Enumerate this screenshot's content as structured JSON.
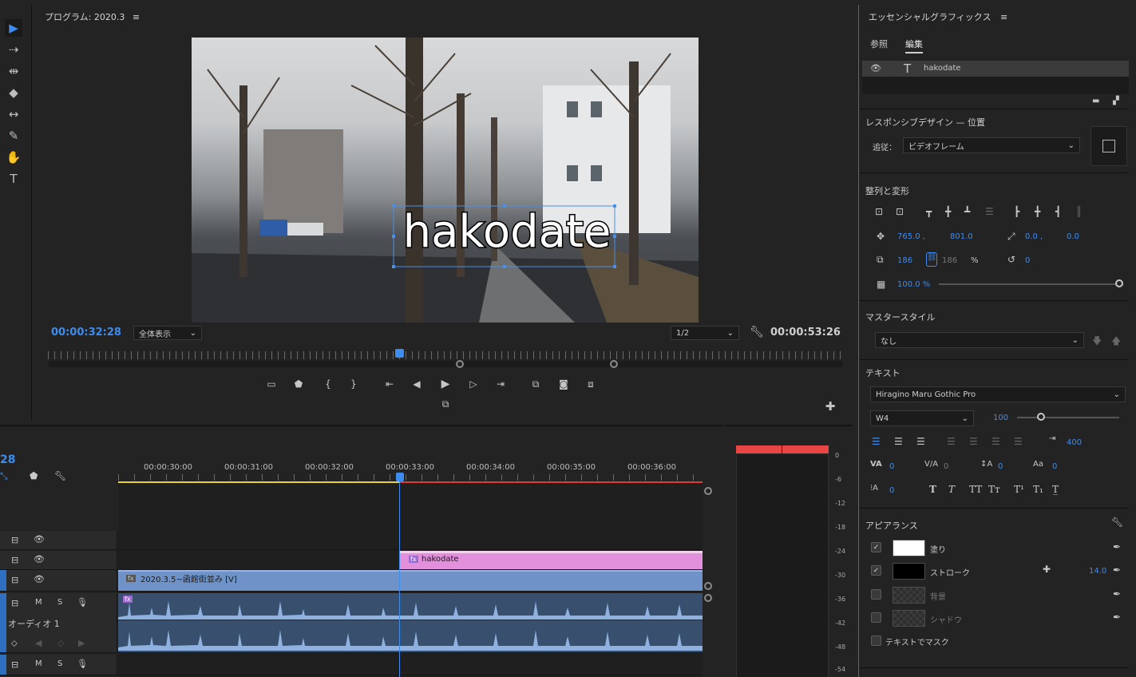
{
  "program": {
    "title": "プログラム: 2020.3",
    "menu_glyph": "≡",
    "current_tc": "00:00:32:28",
    "zoom": "全体表示",
    "resolution": "1/2",
    "duration_tc": "00:00:53:26",
    "overlay_text": "hakodate"
  },
  "tools": [
    "select-tool",
    "track-select-tool",
    "ripple-edit-tool",
    "razor-tool",
    "slip-tool",
    "pen-tool",
    "hand-tool",
    "type-tool"
  ],
  "timeline": {
    "tc_partial": "28",
    "ruler": [
      "00:00:30:00",
      "00:00:31:00",
      "00:00:32:00",
      "00:00:33:00",
      "00:00:34:00",
      "00:00:35:00",
      "00:00:36:00"
    ],
    "clip_graphic": "hakodate",
    "clip_video": "2020.3.5~函館街並み [V]",
    "audio_track_name": "オーディオ 1",
    "m_label": "M",
    "s_label": "S",
    "fx_label": "fx"
  },
  "meter": {
    "labels": [
      "0",
      "-6",
      "-12",
      "-18",
      "-24",
      "-30",
      "-36",
      "-42",
      "-48",
      "-54"
    ]
  },
  "eg": {
    "title": "エッセンシャルグラフィックス",
    "tab_browse": "参照",
    "tab_edit": "編集",
    "layer_name": "hakodate",
    "responsive_title": "レスポンシブデザイン — 位置",
    "follow_label": "追従：",
    "follow_value": "ビデオフレーム",
    "align_title": "整列と変形",
    "pos_x": "765.0 ,",
    "pos_y": "801.0",
    "anchor_x": "0.0 ,",
    "anchor_y": "0.0",
    "scale_w": "186",
    "scale_h": "186",
    "scale_unit": "%",
    "rotation": "0",
    "opacity": "100.0 %",
    "master_title": "マスタースタイル",
    "master_value": "なし",
    "text_title": "テキスト",
    "font_family": "Hiragino Maru Gothic Pro",
    "font_weight": "W4",
    "font_size": "100",
    "tab_value": "400",
    "kern": "0",
    "track": "0",
    "lead": "0",
    "baseline": "0",
    "tsume": "0",
    "style_buttons": [
      "T",
      "T",
      "TT",
      "Tт",
      "T¹",
      "T₁",
      "T̲"
    ],
    "appearance_title": "アピアランス",
    "fill_label": "塗り",
    "stroke_label": "ストローク",
    "stroke_value": "14.0",
    "bg_label": "背景",
    "shadow_label": "シャドウ",
    "mask_label": "テキストでマスク",
    "fill_color": "#ffffff",
    "stroke_color": "#000000",
    "accent": "#3d8cf0"
  }
}
